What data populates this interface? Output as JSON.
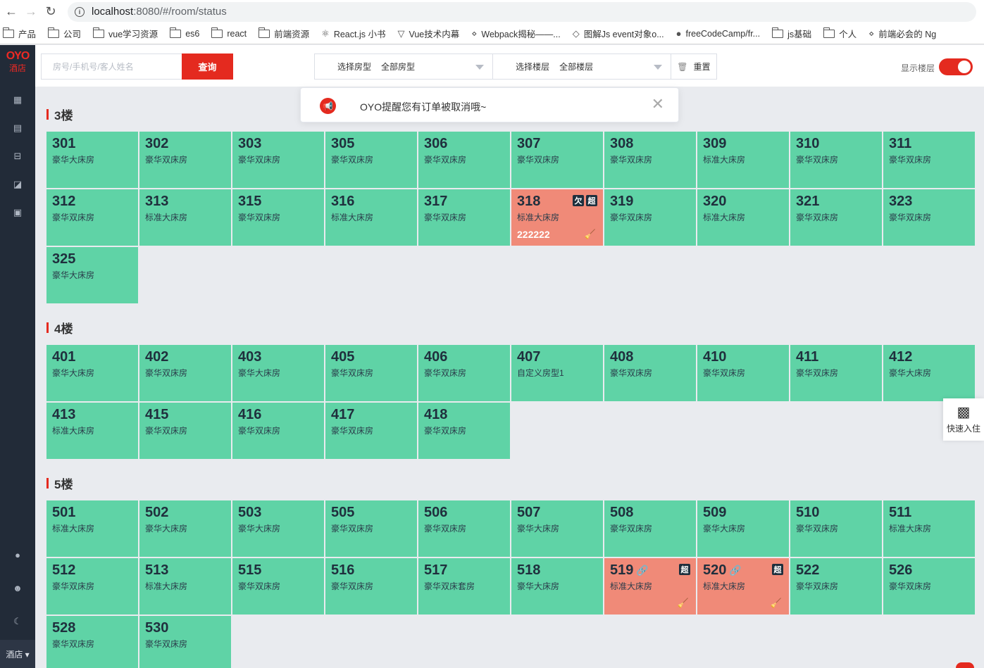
{
  "browser": {
    "url_host": "localhost",
    "url_path": ":8080/#/room/status",
    "bookmarks": [
      {
        "label": "产品",
        "icon": "folder-icon"
      },
      {
        "label": "公司",
        "icon": "folder-icon"
      },
      {
        "label": "vue学习资源",
        "icon": "folder-icon"
      },
      {
        "label": "es6",
        "icon": "folder-icon"
      },
      {
        "label": "react",
        "icon": "folder-icon"
      },
      {
        "label": "前端资源",
        "icon": "folder-icon"
      },
      {
        "label": "React.js 小书",
        "icon": "react-icon"
      },
      {
        "label": "Vue技术内幕",
        "icon": "vue-icon"
      },
      {
        "label": "Webpack揭秘——...",
        "icon": "webpack-icon"
      },
      {
        "label": "图解Js event对象o...",
        "icon": "page-icon"
      },
      {
        "label": "freeCodeCamp/fr...",
        "icon": "github-icon"
      },
      {
        "label": "js基础",
        "icon": "folder-icon"
      },
      {
        "label": "个人",
        "icon": "folder-icon"
      },
      {
        "label": "前端必会的 Ng",
        "icon": "webpack-icon"
      }
    ]
  },
  "sidebar": {
    "logo_text": "OYO",
    "logo_sub": "酒店",
    "bottom_label": "酒店 ▾",
    "icons": [
      "grid-icon",
      "document-icon",
      "bed-icon",
      "chart-icon",
      "monitor-icon",
      "bell-icon",
      "user-icon",
      "moon-icon"
    ]
  },
  "toolbar": {
    "search_placeholder": "房号/手机号/客人姓名",
    "search_button": "查询",
    "room_type_label": "选择房型",
    "room_type_value": "全部房型",
    "floor_label": "选择楼层",
    "floor_value": "全部楼层",
    "reset_label": "重置",
    "show_floor_label": "显示楼层",
    "show_floor_on": true
  },
  "notification": {
    "message": "OYO提醒您有订单被取消哦~"
  },
  "quick_checkin": {
    "label": "快速入住"
  },
  "colors": {
    "vacant": "#5fd3a6",
    "alert": "#f08a78",
    "brand": "#e42a1f"
  },
  "floors": [
    {
      "title": "3楼",
      "rooms": [
        {
          "num": "301",
          "type": "豪华大床房"
        },
        {
          "num": "302",
          "type": "豪华双床房"
        },
        {
          "num": "303",
          "type": "豪华双床房"
        },
        {
          "num": "305",
          "type": "豪华双床房"
        },
        {
          "num": "306",
          "type": "豪华双床房"
        },
        {
          "num": "307",
          "type": "豪华双床房"
        },
        {
          "num": "308",
          "type": "豪华双床房"
        },
        {
          "num": "309",
          "type": "标准大床房"
        },
        {
          "num": "310",
          "type": "豪华双床房"
        },
        {
          "num": "311",
          "type": "豪华双床房"
        },
        {
          "num": "312",
          "type": "豪华双床房"
        },
        {
          "num": "313",
          "type": "标准大床房"
        },
        {
          "num": "315",
          "type": "豪华双床房"
        },
        {
          "num": "316",
          "type": "标准大床房"
        },
        {
          "num": "317",
          "type": "豪华双床房"
        },
        {
          "num": "318",
          "type": "标准大床房",
          "alert": true,
          "badges": [
            "欠",
            "超"
          ],
          "guest": "222222",
          "dirty": true
        },
        {
          "num": "319",
          "type": "豪华双床房"
        },
        {
          "num": "320",
          "type": "标准大床房"
        },
        {
          "num": "321",
          "type": "豪华双床房"
        },
        {
          "num": "323",
          "type": "豪华双床房"
        },
        {
          "num": "325",
          "type": "豪华大床房"
        }
      ]
    },
    {
      "title": "4楼",
      "rooms": [
        {
          "num": "401",
          "type": "豪华大床房"
        },
        {
          "num": "402",
          "type": "豪华双床房"
        },
        {
          "num": "403",
          "type": "豪华大床房"
        },
        {
          "num": "405",
          "type": "豪华双床房"
        },
        {
          "num": "406",
          "type": "豪华双床房"
        },
        {
          "num": "407",
          "type": "自定义房型1"
        },
        {
          "num": "408",
          "type": "豪华双床房"
        },
        {
          "num": "410",
          "type": "豪华双床房"
        },
        {
          "num": "411",
          "type": "豪华双床房"
        },
        {
          "num": "412",
          "type": "豪华大床房"
        },
        {
          "num": "413",
          "type": "标准大床房"
        },
        {
          "num": "415",
          "type": "豪华双床房"
        },
        {
          "num": "416",
          "type": "豪华双床房"
        },
        {
          "num": "417",
          "type": "豪华双床房"
        },
        {
          "num": "418",
          "type": "豪华双床房"
        }
      ]
    },
    {
      "title": "5楼",
      "rooms": [
        {
          "num": "501",
          "type": "标准大床房"
        },
        {
          "num": "502",
          "type": "豪华大床房"
        },
        {
          "num": "503",
          "type": "豪华大床房"
        },
        {
          "num": "505",
          "type": "豪华双床房"
        },
        {
          "num": "506",
          "type": "豪华双床房"
        },
        {
          "num": "507",
          "type": "豪华大床房"
        },
        {
          "num": "508",
          "type": "豪华双床房"
        },
        {
          "num": "509",
          "type": "豪华大床房"
        },
        {
          "num": "510",
          "type": "豪华双床房"
        },
        {
          "num": "511",
          "type": "标准大床房"
        },
        {
          "num": "512",
          "type": "豪华双床房"
        },
        {
          "num": "513",
          "type": "标准大床房"
        },
        {
          "num": "515",
          "type": "豪华双床房"
        },
        {
          "num": "516",
          "type": "豪华双床房"
        },
        {
          "num": "517",
          "type": "豪华双床套房"
        },
        {
          "num": "518",
          "type": "豪华大床房"
        },
        {
          "num": "519",
          "type": "标准大床房",
          "alert": true,
          "linked": true,
          "badges": [
            "超"
          ],
          "dirty": true
        },
        {
          "num": "520",
          "type": "标准大床房",
          "alert": true,
          "linked": true,
          "badges": [
            "超"
          ],
          "dirty": true
        },
        {
          "num": "522",
          "type": "豪华双床房"
        },
        {
          "num": "526",
          "type": "豪华双床房"
        },
        {
          "num": "528",
          "type": "豪华双床房"
        },
        {
          "num": "530",
          "type": "豪华双床房"
        }
      ]
    }
  ]
}
